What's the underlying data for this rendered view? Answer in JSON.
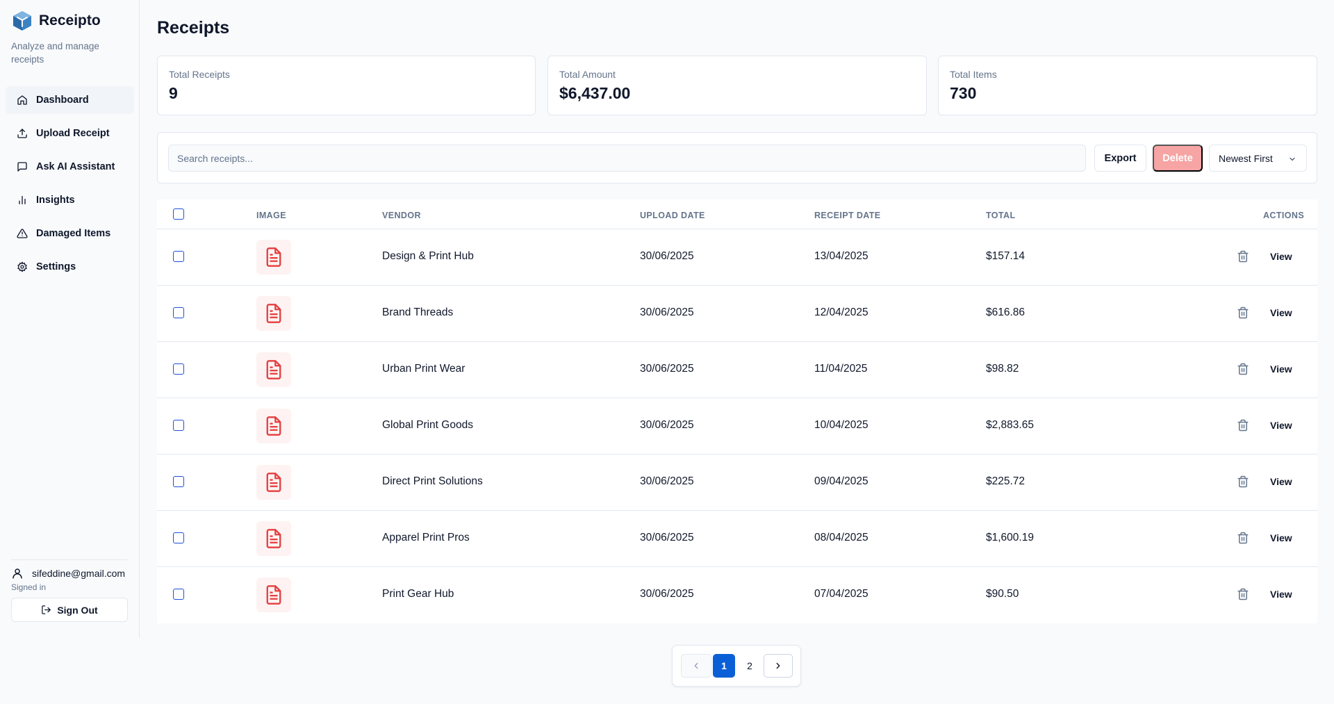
{
  "app": {
    "name": "Receipto",
    "tagline": "Analyze and manage receipts"
  },
  "sidebar": {
    "items": [
      {
        "label": "Dashboard",
        "icon": "home-icon",
        "active": true
      },
      {
        "label": "Upload Receipt",
        "icon": "upload-icon"
      },
      {
        "label": "Ask AI Assistant",
        "icon": "message-icon"
      },
      {
        "label": "Insights",
        "icon": "bar-chart-icon"
      },
      {
        "label": "Damaged Items",
        "icon": "warning-icon"
      },
      {
        "label": "Settings",
        "icon": "gear-icon"
      }
    ],
    "user": {
      "email": "sifeddine@gmail.com",
      "status": "Signed in",
      "signout_label": "Sign Out"
    }
  },
  "page": {
    "title": "Receipts"
  },
  "stats": [
    {
      "label": "Total Receipts",
      "value": "9"
    },
    {
      "label": "Total Amount",
      "value": "$6,437.00"
    },
    {
      "label": "Total Items",
      "value": "730"
    }
  ],
  "toolbar": {
    "search_placeholder": "Search receipts...",
    "export_label": "Export",
    "delete_label": "Delete",
    "sort_label": "Newest First"
  },
  "table": {
    "columns": {
      "image": "IMAGE",
      "vendor": "VENDOR",
      "upload_date": "UPLOAD DATE",
      "receipt_date": "RECEIPT DATE",
      "total": "TOTAL",
      "actions": "ACTIONS"
    },
    "view_label": "View",
    "rows": [
      {
        "vendor": "Design & Print Hub",
        "upload_date": "30/06/2025",
        "receipt_date": "13/04/2025",
        "total": "$157.14"
      },
      {
        "vendor": "Brand Threads",
        "upload_date": "30/06/2025",
        "receipt_date": "12/04/2025",
        "total": "$616.86"
      },
      {
        "vendor": "Urban Print Wear",
        "upload_date": "30/06/2025",
        "receipt_date": "11/04/2025",
        "total": "$98.82"
      },
      {
        "vendor": "Global Print Goods",
        "upload_date": "30/06/2025",
        "receipt_date": "10/04/2025",
        "total": "$2,883.65"
      },
      {
        "vendor": "Direct Print Solutions",
        "upload_date": "30/06/2025",
        "receipt_date": "09/04/2025",
        "total": "$225.72"
      },
      {
        "vendor": "Apparel Print Pros",
        "upload_date": "30/06/2025",
        "receipt_date": "08/04/2025",
        "total": "$1,600.19"
      },
      {
        "vendor": "Print Gear Hub",
        "upload_date": "30/06/2025",
        "receipt_date": "07/04/2025",
        "total": "$90.50"
      }
    ]
  },
  "pagination": {
    "pages": [
      "1",
      "2"
    ],
    "current": "1"
  },
  "colors": {
    "primary": "#0b5fd6",
    "danger_disabled": "#f6a4a4",
    "receipt_icon": "#e53e3e"
  }
}
